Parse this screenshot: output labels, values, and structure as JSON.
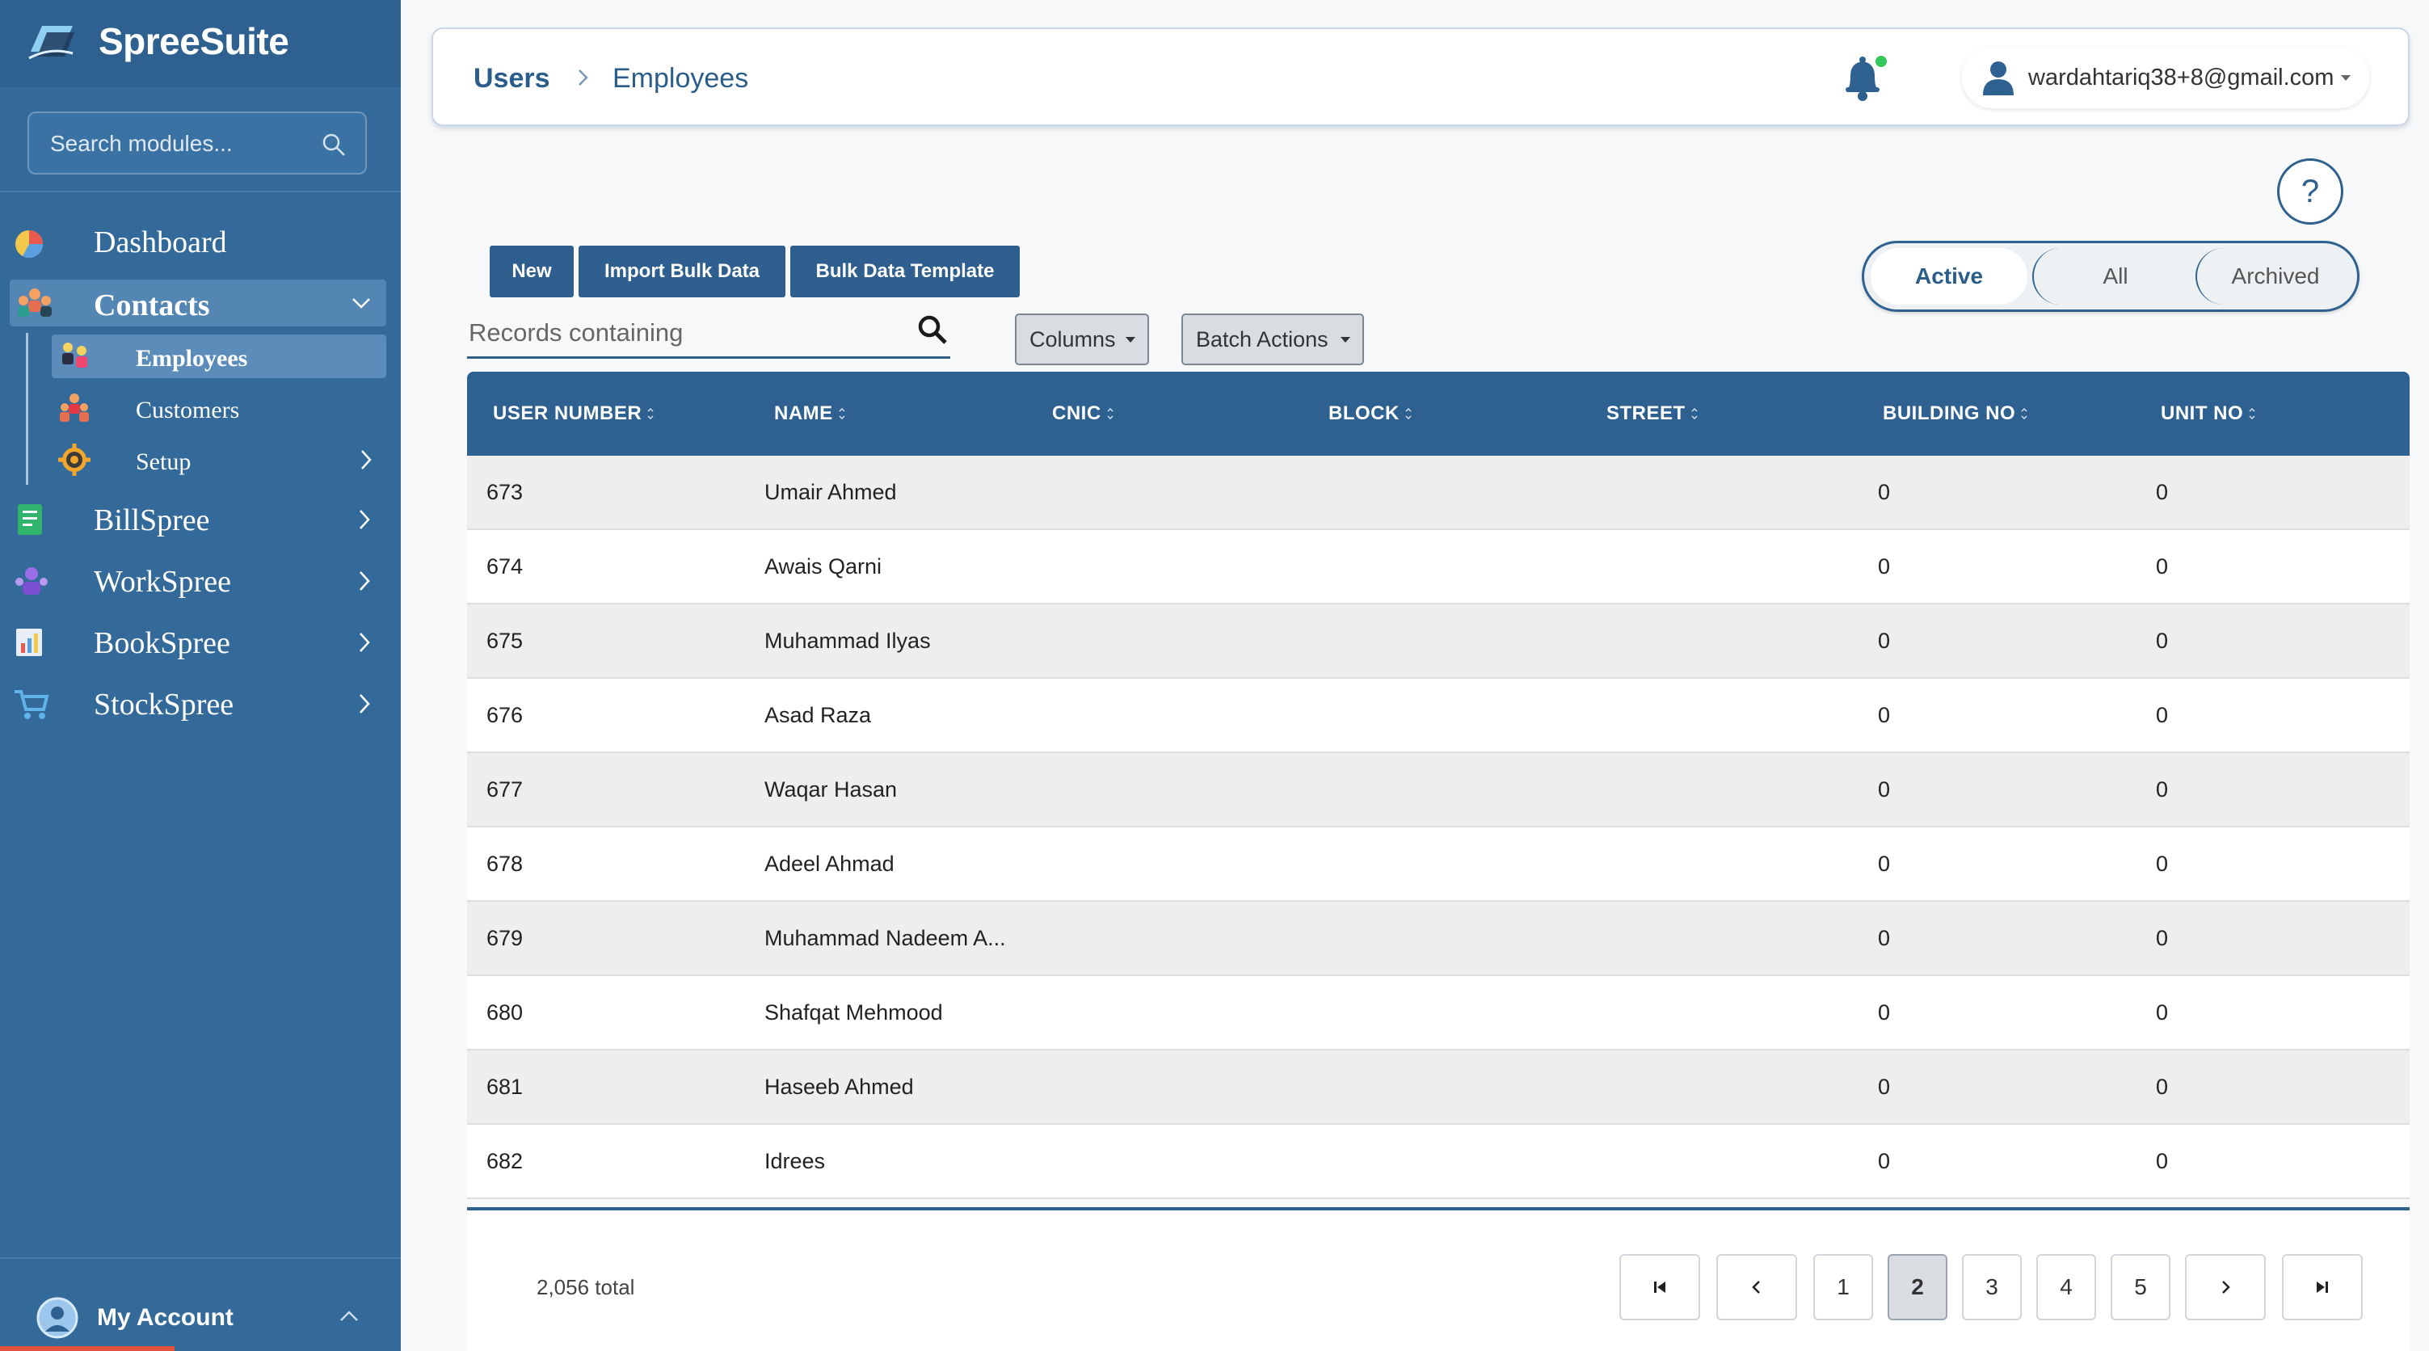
{
  "brand": {
    "name": "SpreeSuite"
  },
  "sidebar": {
    "search_placeholder": "Search modules...",
    "items": [
      {
        "label": "Dashboard",
        "icon": "pie-chart-icon"
      },
      {
        "label": "Contacts",
        "icon": "people-icon",
        "expanded": true
      },
      {
        "label": "BillSpree",
        "icon": "receipt-icon"
      },
      {
        "label": "WorkSpree",
        "icon": "team-icon"
      },
      {
        "label": "BookSpree",
        "icon": "ledger-icon"
      },
      {
        "label": "StockSpree",
        "icon": "cart-icon"
      }
    ],
    "contacts_sub": [
      {
        "label": "Employees",
        "icon": "employees-icon",
        "active": true
      },
      {
        "label": "Customers",
        "icon": "customers-icon"
      },
      {
        "label": "Setup",
        "icon": "gear-icon"
      }
    ],
    "account_label": "My Account"
  },
  "topbar": {
    "breadcrumb": [
      "Users",
      "Employees"
    ],
    "user_email": "wardahtariq38+8@gmail.com"
  },
  "toolbar": {
    "new_label": "New",
    "import_label": "Import Bulk Data",
    "template_label": "Bulk Data Template",
    "records_placeholder": "Records containing",
    "columns_label": "Columns",
    "batch_label": "Batch Actions"
  },
  "filter_toggle": {
    "active": "Active",
    "all": "All",
    "archived": "Archived",
    "selected": "Active"
  },
  "table": {
    "headers": [
      "USER NUMBER",
      "NAME",
      "CNIC",
      "BLOCK",
      "STREET",
      "BUILDING NO",
      "UNIT NO"
    ],
    "rows": [
      {
        "user_number": "673",
        "name": "Umair Ahmed",
        "cnic": "",
        "block": "",
        "street": "",
        "building_no": "0",
        "unit_no": "0"
      },
      {
        "user_number": "674",
        "name": "Awais Qarni",
        "cnic": "",
        "block": "",
        "street": "",
        "building_no": "0",
        "unit_no": "0"
      },
      {
        "user_number": "675",
        "name": "Muhammad Ilyas",
        "cnic": "",
        "block": "",
        "street": "",
        "building_no": "0",
        "unit_no": "0"
      },
      {
        "user_number": "676",
        "name": "Asad Raza",
        "cnic": "",
        "block": "",
        "street": "",
        "building_no": "0",
        "unit_no": "0"
      },
      {
        "user_number": "677",
        "name": "Waqar Hasan",
        "cnic": "",
        "block": "",
        "street": "",
        "building_no": "0",
        "unit_no": "0"
      },
      {
        "user_number": "678",
        "name": "Adeel Ahmad",
        "cnic": "",
        "block": "",
        "street": "",
        "building_no": "0",
        "unit_no": "0"
      },
      {
        "user_number": "679",
        "name": "Muhammad Nadeem A...",
        "cnic": "",
        "block": "",
        "street": "",
        "building_no": "0",
        "unit_no": "0"
      },
      {
        "user_number": "680",
        "name": "Shafqat Mehmood",
        "cnic": "",
        "block": "",
        "street": "",
        "building_no": "0",
        "unit_no": "0"
      },
      {
        "user_number": "681",
        "name": "Haseeb Ahmed",
        "cnic": "",
        "block": "",
        "street": "",
        "building_no": "0",
        "unit_no": "0"
      },
      {
        "user_number": "682",
        "name": "Idrees",
        "cnic": "",
        "block": "",
        "street": "",
        "building_no": "0",
        "unit_no": "0"
      }
    ]
  },
  "pagination": {
    "total": "2,056 total",
    "pages": [
      "1",
      "2",
      "3",
      "4",
      "5"
    ],
    "current": "2"
  },
  "colors": {
    "sidebar": "#336a9a",
    "accent": "#2e6190",
    "notification_dot": "#35c85a"
  }
}
